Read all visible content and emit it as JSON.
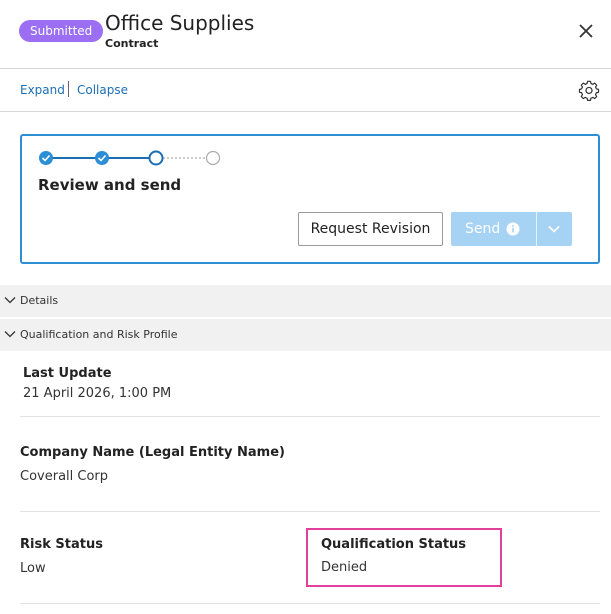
{
  "header": {
    "status_badge": "Submitted",
    "title": "Office Supplies",
    "subtitle": "Contract"
  },
  "toolbar": {
    "expand_label": "Expand",
    "collapse_label": "Collapse"
  },
  "workflow": {
    "steps_completed": 2,
    "steps_total": 4,
    "current_step_title": "Review and send",
    "request_revision_label": "Request Revision",
    "send_label": "Send"
  },
  "sections": {
    "details_label": "Details",
    "qualification_label": "Qualification and Risk Profile"
  },
  "fields": {
    "last_update_label": "Last Update",
    "last_update_value": "21 April 2026, 1:00 PM",
    "company_label": "Company Name (Legal Entity Name)",
    "company_value": "Coverall Corp",
    "risk_label": "Risk Status",
    "risk_value": "Low",
    "qualification_label": "Qualification Status",
    "qualification_value": "Denied"
  },
  "colors": {
    "badge": "#9b6ef3",
    "accent": "#2c8fd6",
    "link": "#1c6eb4",
    "highlight": "#e0409b",
    "send_disabled": "#a6d3f4"
  },
  "icons": {
    "close": "close-icon",
    "settings": "gear-icon",
    "info": "info-icon",
    "chevron": "chevron-down-icon",
    "check": "check-icon"
  }
}
